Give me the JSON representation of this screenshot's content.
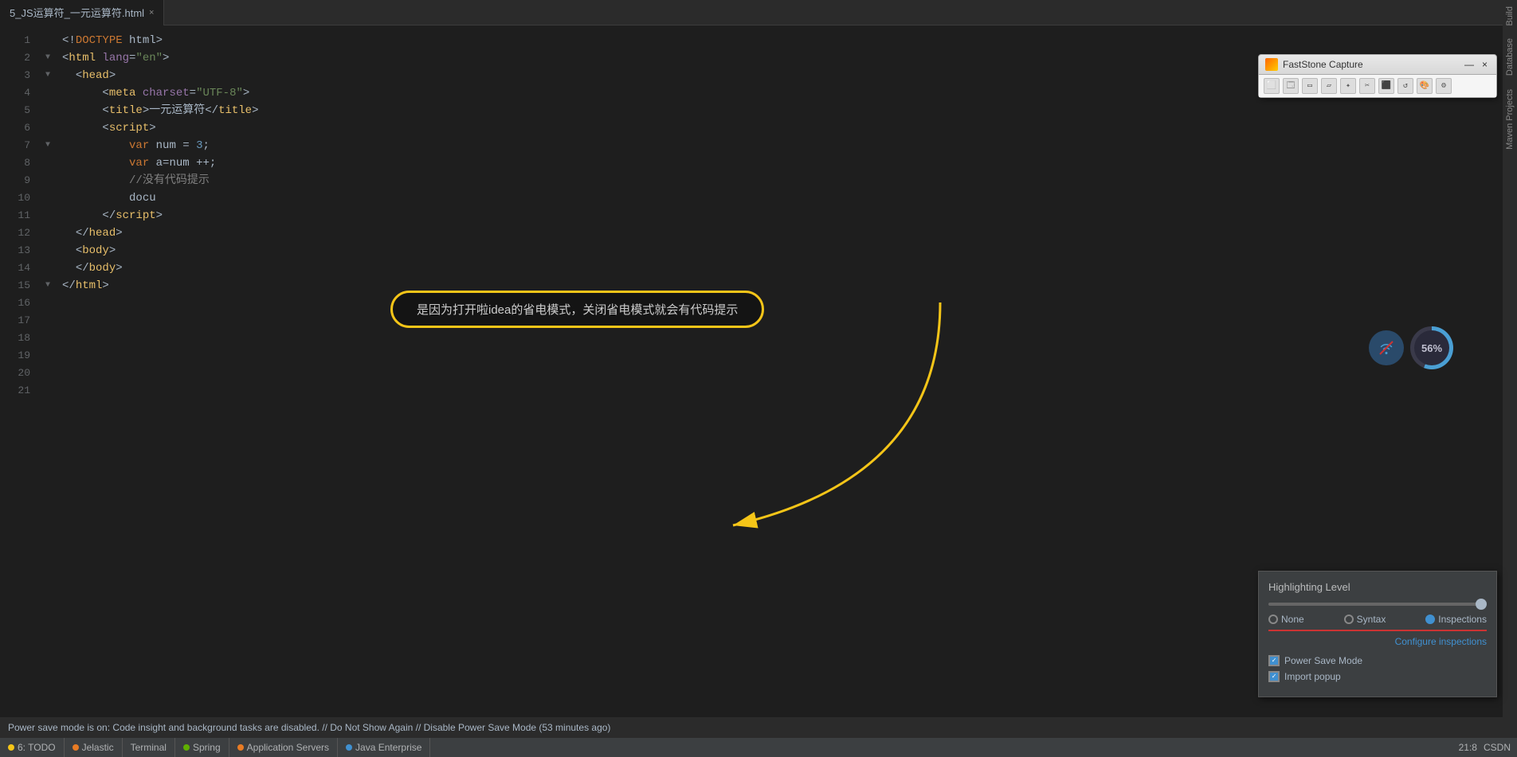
{
  "tab": {
    "label": "5_JS运算符_一元运算符.html",
    "close": "×"
  },
  "code": {
    "lines": [
      {
        "num": 1,
        "fold": "",
        "content": "&lt;!DOCTYPE html&gt;"
      },
      {
        "num": 2,
        "fold": "▼",
        "content": "&lt;html lang=\"en\"&gt;"
      },
      {
        "num": 3,
        "fold": "▼",
        "content": "  &lt;head&gt;"
      },
      {
        "num": 4,
        "fold": "",
        "content": "      &lt;meta charset=\"UTF-8\"&gt;"
      },
      {
        "num": 5,
        "fold": "",
        "content": "      &lt;title&gt;一元运算符&lt;/title&gt;"
      },
      {
        "num": 6,
        "fold": "",
        "content": ""
      },
      {
        "num": 7,
        "fold": "▼",
        "content": "      &lt;script&gt;"
      },
      {
        "num": 8,
        "fold": "",
        "content": ""
      },
      {
        "num": 9,
        "fold": "",
        "content": "          var num = 3;"
      },
      {
        "num": 10,
        "fold": "",
        "content": "          var a=num ++;"
      },
      {
        "num": 11,
        "fold": "",
        "content": ""
      },
      {
        "num": 12,
        "fold": "",
        "content": "          //没有代码提示"
      },
      {
        "num": 13,
        "fold": "",
        "content": "          docu"
      },
      {
        "num": 14,
        "fold": "",
        "content": ""
      },
      {
        "num": 15,
        "fold": "▼",
        "content": "      &lt;/script&gt;"
      },
      {
        "num": 16,
        "fold": "",
        "content": ""
      },
      {
        "num": 17,
        "fold": "",
        "content": "  &lt;/head&gt;"
      },
      {
        "num": 18,
        "fold": "",
        "content": "  &lt;body&gt;"
      },
      {
        "num": 19,
        "fold": "",
        "content": ""
      },
      {
        "num": 20,
        "fold": "",
        "content": "  &lt;/body&gt;"
      },
      {
        "num": 21,
        "fold": "",
        "content": "&lt;/html&gt;"
      }
    ]
  },
  "annotation": {
    "bubble_text": "是因为打开啦idea的省电模式，关闭省电模式就会有代码提示"
  },
  "faststone": {
    "title": "FastStone Capture",
    "minimize": "—",
    "close": "×"
  },
  "battery": {
    "percent": "56%"
  },
  "highlighting": {
    "title": "Highlighting Level",
    "none_label": "None",
    "syntax_label": "Syntax",
    "inspections_label": "Inspections",
    "configure_label": "Configure inspections",
    "power_save_label": "Power Save Mode",
    "import_popup_label": "Import popup"
  },
  "statusbar": {
    "info_text": "Power save mode is on: Code insight and background tasks are disabled. // Do Not Show Again // Disable Power Save Mode (53 minutes ago)",
    "position": "21:8",
    "encoding": "CSDN",
    "items": [
      {
        "label": "6: TODO",
        "color": "yellow"
      },
      {
        "label": "Jelastic",
        "color": "orange"
      },
      {
        "label": "Terminal",
        "color": "none"
      },
      {
        "label": "Spring",
        "color": "green"
      },
      {
        "label": "Application Servers",
        "color": "orange"
      },
      {
        "label": "Java Enterprise",
        "color": "blue"
      }
    ]
  },
  "right_sidebar": {
    "tabs": [
      "Build",
      "Database",
      "Maven Projects"
    ]
  }
}
